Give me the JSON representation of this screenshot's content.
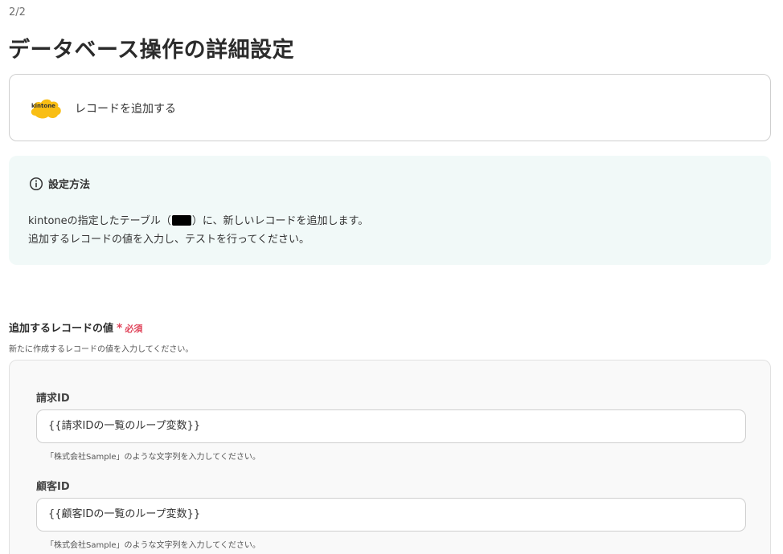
{
  "header": {
    "step": "2/2",
    "title": "データベース操作の詳細設定"
  },
  "app": {
    "logo_text": "kintone",
    "action_label": "レコードを追加する",
    "brand_color": "#f9be14"
  },
  "info": {
    "icon": "info-circle-icon",
    "title": "設定方法",
    "line1_before": "kintoneの指定したテーブル（",
    "line1_after": "）に、新しいレコードを追加します。",
    "line2": "追加するレコードの値を入力し、テストを行ってください。"
  },
  "section": {
    "label": "追加するレコードの値",
    "required_star": "*",
    "required_text": "必須",
    "description": "新たに作成するレコードの値を入力してください。",
    "required_color": "#e0455b"
  },
  "fields": [
    {
      "label": "請求ID",
      "value": "{{請求IDの一覧のループ変数}}",
      "hint": "「株式会社Sample」のような文字列を入力してください。"
    },
    {
      "label": "顧客ID",
      "value": "{{顧客IDの一覧のループ変数}}",
      "hint": "「株式会社Sample」のような文字列を入力してください。"
    }
  ]
}
